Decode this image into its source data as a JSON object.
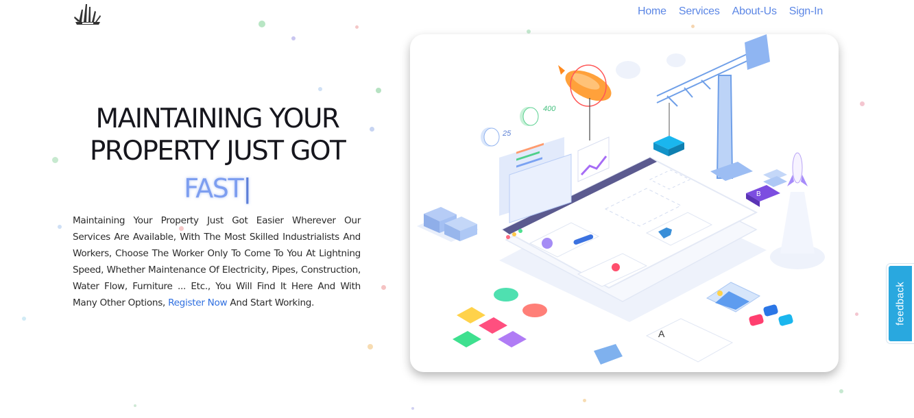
{
  "brand": {
    "logo_icon": "industrial-tools-logo"
  },
  "nav": {
    "items": [
      "Home",
      "Services",
      "About-Us",
      "Sign-In"
    ],
    "color": "#5b86e5"
  },
  "hero": {
    "headline_line1": "MAINTAINING YOUR",
    "headline_line2": "PROPERTY JUST GOT",
    "typed_word": "FAST",
    "typed_cursor": "|",
    "description_before_link": "Maintaining Your Property Just Got Easier Wherever Our Services Are Available, With The Most Skilled Industrialists And Workers, Choose The Worker Only To Come To You At Lightning Speed, Whether Maintenance Of Electricity, Pipes, Construction, Water Flow, Furniture ... Etc., You Will Find It Here And With Many Other Options,",
    "link_text": "Register Now",
    "description_after_link": "And Start Working.",
    "typed_color": "#7d9ef0",
    "link_color": "#2f6fe0"
  },
  "illustration": {
    "subject": "isometric-web-development-illustration",
    "labels": [
      "25",
      "400"
    ]
  },
  "feedback_tab": {
    "label": "feedback",
    "color": "#29a8df"
  }
}
